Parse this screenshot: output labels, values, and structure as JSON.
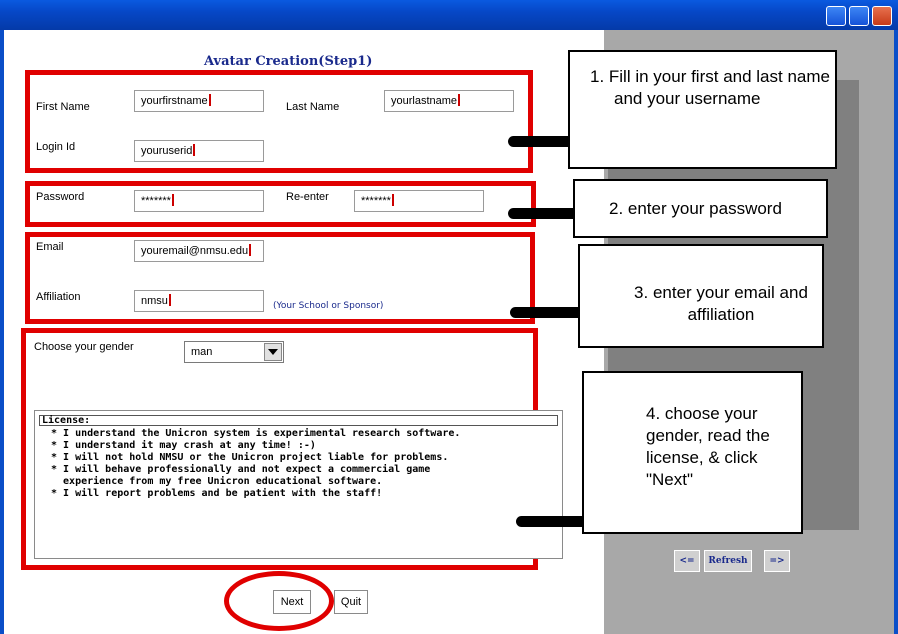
{
  "page": {
    "title": "Avatar Creation(Step1)"
  },
  "form": {
    "first_name_label": "First Name",
    "first_name_value": "yourfirstname",
    "last_name_label": "Last Name",
    "last_name_value": "yourlastname",
    "login_label": "Login Id",
    "login_value": "youruserid",
    "password_label": "Password",
    "password_value": "*******",
    "reenter_label": "Re-enter",
    "reenter_value": "*******",
    "email_label": "Email",
    "email_value": "youremail@nmsu.edu",
    "affiliation_label": "Affiliation",
    "affiliation_value": "nmsu",
    "affiliation_hint": "(Your School or Sponsor)",
    "gender_label": "Choose your gender",
    "gender_value": "man"
  },
  "license": {
    "heading": "License:",
    "lines": [
      "* I understand the Unicron system is experimental research software.",
      "* I understand it may crash at any time! :-)",
      "* I will not hold NMSU or the Unicron project liable for problems.",
      "* I will behave professionally and not expect a commercial game",
      "  experience from my free Unicron educational software.",
      "* I will report problems and be patient with the staff!"
    ]
  },
  "buttons": {
    "next": "Next",
    "quit": "Quit",
    "prev": "<=",
    "refresh": "Refresh",
    "forward": "=>"
  },
  "callouts": {
    "step1": "1. Fill in your first and last name and your username",
    "step2": "2. enter your password",
    "step3": "3. enter your email and affiliation",
    "step4": "4. choose your gender, read the license, & click \"Next\""
  },
  "colors": {
    "highlight": "#e00000",
    "title_blue": "#1a2a8c"
  }
}
